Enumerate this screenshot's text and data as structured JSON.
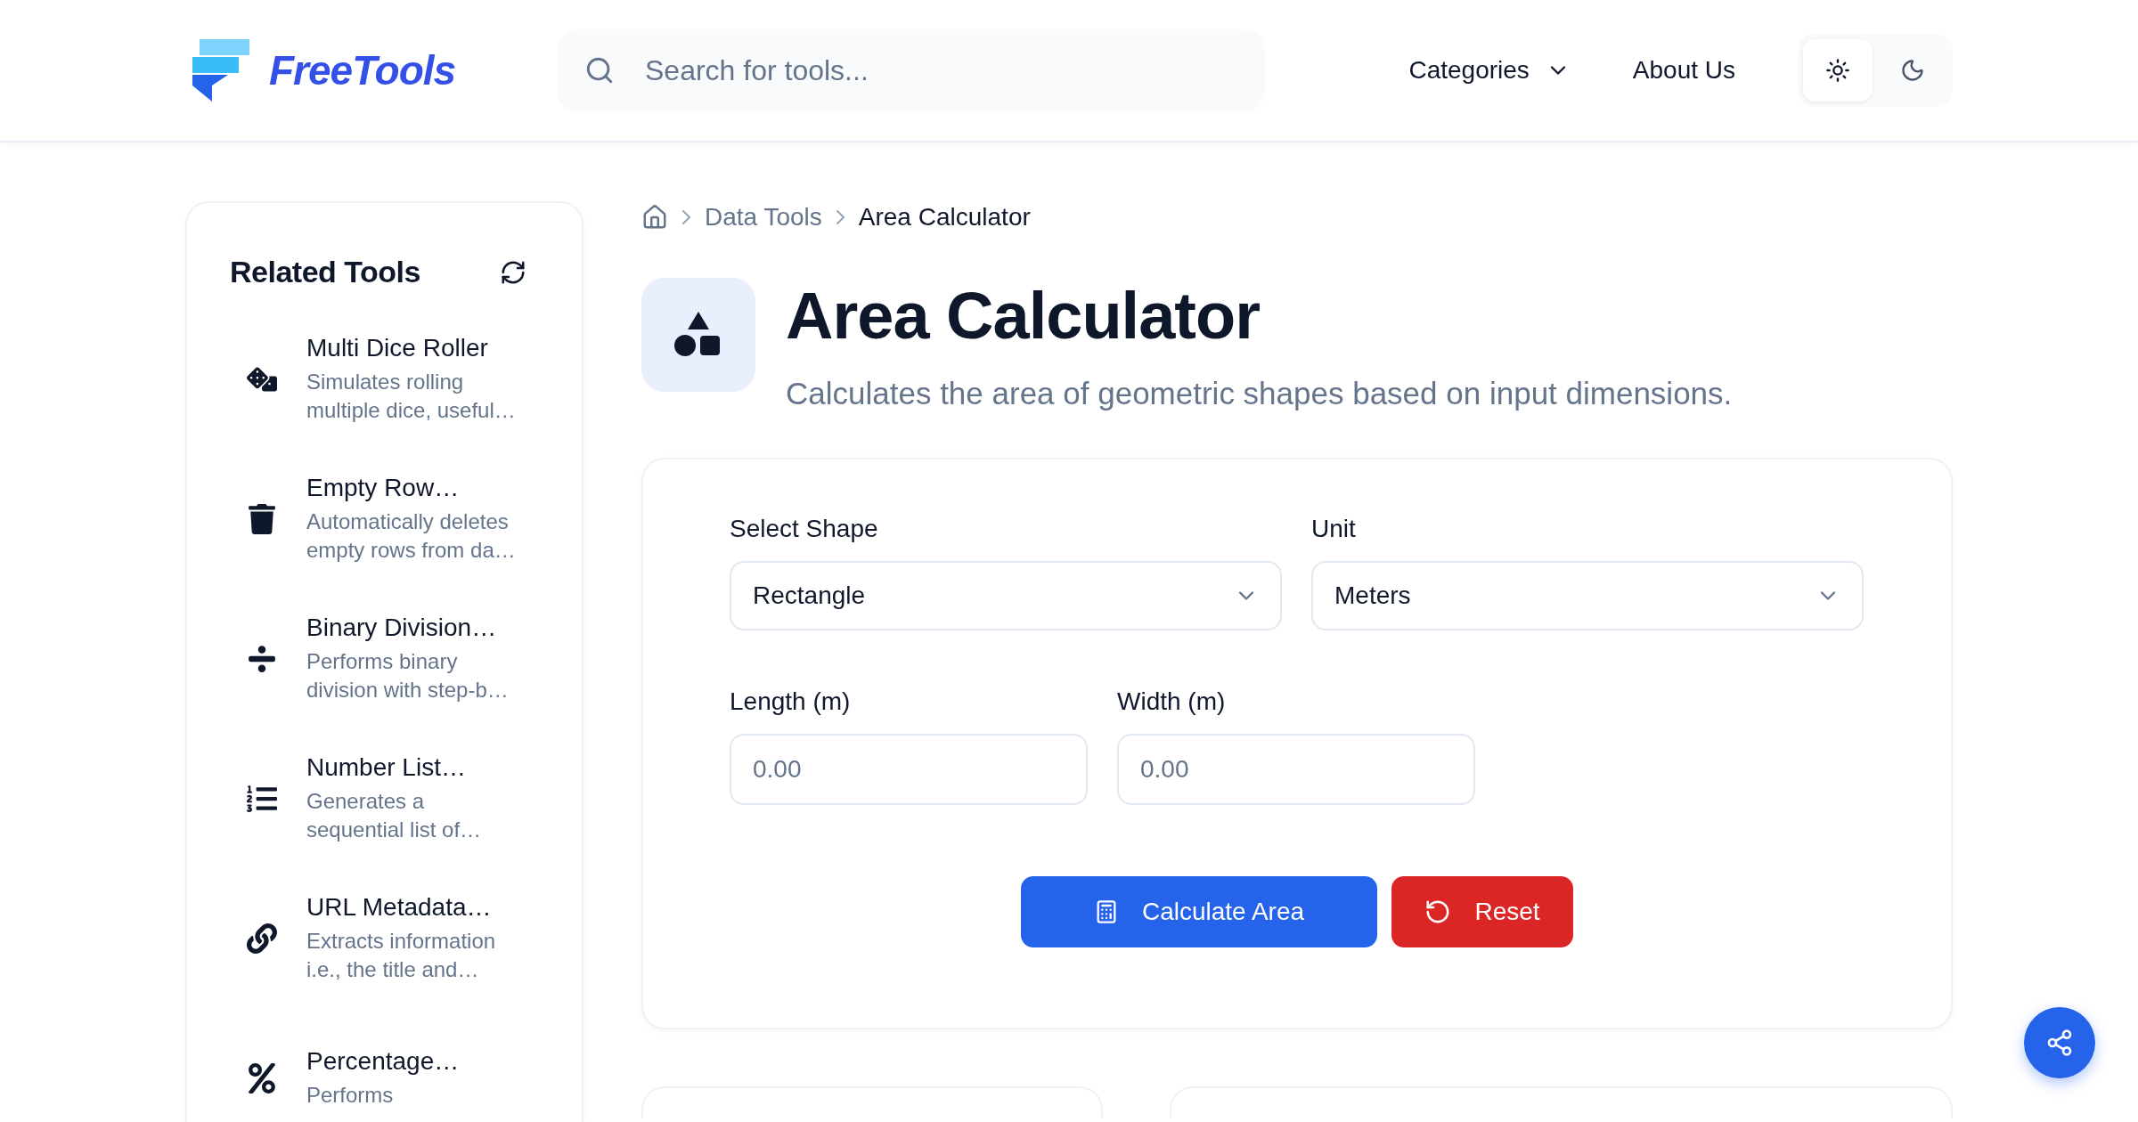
{
  "header": {
    "logo": "FreeTools",
    "search": {
      "placeholder": "Search for tools..."
    },
    "nav": [
      {
        "label": "Categories",
        "kind": "dropdown"
      },
      {
        "label": "About Us",
        "kind": "link"
      }
    ],
    "theme_options": [
      {
        "kind": "light",
        "selected": true
      },
      {
        "kind": "dark",
        "selected": false
      }
    ]
  },
  "sidebar": {
    "title": "Related Tools",
    "items": [
      {
        "kind": "dice",
        "title": "Multi Dice Roller",
        "description": "Simulates rolling multiple dice, useful…"
      },
      {
        "kind": "trash",
        "title": "Empty Row…",
        "description": "Automatically deletes empty rows from da…"
      },
      {
        "kind": "divide",
        "title": "Binary Division…",
        "description": "Performs binary division with step-b…"
      },
      {
        "kind": "list",
        "title": "Number List…",
        "description": "Generates a sequential list of…"
      },
      {
        "kind": "link",
        "title": "URL Metadata…",
        "description": "Extracts information i.e., the title and…"
      },
      {
        "kind": "percent",
        "title": "Percentage…",
        "description": "Performs"
      }
    ]
  },
  "breadcrumb": [
    {
      "label": "Data Tools",
      "current": false
    },
    {
      "label": "Area Calculator",
      "current": true
    }
  ],
  "tool": {
    "title": "Area Calculator",
    "description": "Calculates the area of geometric shapes based on input dimensions."
  },
  "form": {
    "selects": [
      {
        "label": "Select Shape",
        "value": "Rectangle"
      },
      {
        "label": "Unit",
        "value": "Meters"
      }
    ],
    "inputs": [
      {
        "label": "Length (m)",
        "placeholder": "0.00"
      },
      {
        "label": "Width (m)",
        "placeholder": "0.00"
      }
    ],
    "buttons": [
      {
        "label": "Calculate Area",
        "kind": "primary"
      },
      {
        "label": "Reset",
        "kind": "danger"
      }
    ]
  }
}
